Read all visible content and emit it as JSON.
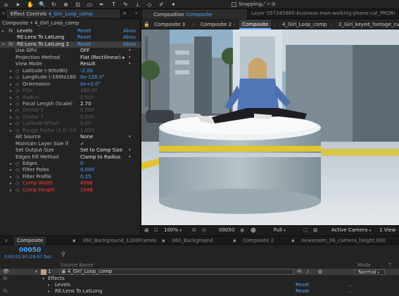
{
  "toolbar": {
    "snapping_label": "Snapping",
    "snapping_icons": "⤢ ⌗ ⊞",
    "tools": [
      {
        "name": "home-icon",
        "glyph": "⌂"
      },
      {
        "name": "selection-tool-icon",
        "glyph": "➤"
      },
      {
        "name": "hand-tool-icon",
        "glyph": "✋"
      },
      {
        "name": "zoom-tool-icon",
        "glyph": "🔍"
      },
      {
        "name": "rotate-tool-icon",
        "glyph": "↻"
      },
      {
        "name": "camera-tool-icon",
        "glyph": "⊕"
      },
      {
        "name": "pan-behind-tool-icon",
        "glyph": "⊡"
      },
      {
        "name": "rectangle-tool-icon",
        "glyph": "▭"
      },
      {
        "name": "pen-tool-icon",
        "glyph": "✒"
      },
      {
        "name": "type-tool-icon",
        "glyph": "T"
      },
      {
        "name": "brush-tool-icon",
        "glyph": "✎"
      },
      {
        "name": "clone-stamp-tool-icon",
        "glyph": "⊥"
      },
      {
        "name": "eraser-tool-icon",
        "glyph": "◇"
      },
      {
        "name": "roto-brush-tool-icon",
        "glyph": "✐"
      },
      {
        "name": "puppet-pin-tool-icon",
        "glyph": "✦"
      }
    ]
  },
  "effect_controls": {
    "close": "×",
    "tab_prefix": "Effect Controls",
    "tab_comp": "4_Girl_Loop_comp",
    "menu": "≡",
    "expand": "»",
    "breadcrumb": "Composite • 4_Girl_Loop_comp",
    "rows": [
      {
        "fx": "fx",
        "label": "Levels",
        "value": "Reset",
        "extra": "Abou",
        "tri": "▸"
      },
      {
        "fx": "",
        "label": "RE:Lens To LatLong",
        "value": "Reset",
        "extra": "Abou",
        "tri": ""
      },
      {
        "fx": "fx",
        "label": "RE:Lens To LatLong 2",
        "value": "Reset",
        "extra": "Abou",
        "tri": "▾"
      },
      {
        "label": "Use GPU",
        "value": "OFF",
        "dd": "▾"
      },
      {
        "label": "Projection Method",
        "value": "Flat (Rectilinear) ▸",
        "dd": "▾"
      },
      {
        "label": "View Mode",
        "value": "Result",
        "dd": "▾"
      },
      {
        "label": "Latitude (-90to90)",
        "value": "-2.00",
        "blue": true
      },
      {
        "label": "Longitude (-180to180",
        "value": "0x-128.0°",
        "blue": true
      },
      {
        "label": "Orientation",
        "value": "0x+0.0°",
        "blue": true
      },
      {
        "label": "FOV",
        "value": "180.00",
        "dim": true
      },
      {
        "label": "Radius",
        "value": "0.500",
        "dim": true
      },
      {
        "label": "Focal Length (Scale)",
        "value": "2.70",
        "blue": false
      },
      {
        "label": "Center X",
        "value": "0.500",
        "dim": true
      },
      {
        "label": "Center Y",
        "value": "0.500",
        "dim": true
      },
      {
        "label": "Latitude Offset",
        "value": "0.00",
        "dim": true
      },
      {
        "label": "Range Factor (1.0~10",
        "value": "1.000",
        "dim": true
      },
      {
        "label": "Alt Source",
        "value": "None",
        "dd": "▾"
      },
      {
        "label": "Maintain Layer Size if",
        "value": "✓"
      },
      {
        "label": "Set Output Size",
        "value": "Set to Comp Size",
        "dd": "▾"
      },
      {
        "label": "Edges Fill Method",
        "value": "Clamp to Radius",
        "dd": "▾"
      },
      {
        "label": "Edges",
        "value": "0",
        "blue": true
      },
      {
        "label": "Filter Poles",
        "value": "0.000",
        "blue": true
      },
      {
        "label": "Filter Profile",
        "value": "0.25",
        "blue": true
      },
      {
        "label": "Comp Width",
        "value": "4096",
        "red": true
      },
      {
        "label": "Comp Height",
        "value": "2048",
        "red": true
      }
    ]
  },
  "composition": {
    "tab_prefix": "Composition",
    "tab_comp": "Composite",
    "layer_tab": "Layer 057245685-business-man-walking-phone-cal_PRORI",
    "flow": [
      "Composite 3",
      "Composite 2",
      "Composite",
      "4_Girl_Loop_comp",
      "2_Girl_keyed_footage_cut"
    ],
    "active_flow": 2,
    "view_bar": {
      "zoom": "100%",
      "timecode": "00050",
      "resolution": "Full",
      "camera": "Active Camera",
      "views": "1 View"
    }
  },
  "timeline_tabs": [
    {
      "label": "Composite",
      "active": true
    },
    {
      "label": "360_Background_1200Frames",
      "active": false
    },
    {
      "label": "360_Background",
      "active": false
    },
    {
      "label": "Composite 2",
      "active": false
    },
    {
      "label": "newsroom_06_camera_height.000",
      "active": false
    }
  ],
  "timeline": {
    "current_time": "00050",
    "frames_info": "0;00;01;20 (29.97 fps)",
    "source_name_header": "Source Name",
    "mode_header": "Mode",
    "t_header": "T",
    "layer_num": "1",
    "layer_name": "4_Girl_Loop_comp",
    "mode": "Normal",
    "effects_label": "Effects",
    "levels_label": "Levels",
    "levels_reset": "Reset",
    "lens_label": "RE:Lens To LatLong",
    "lens_reset": "Reset",
    "dots": "...."
  },
  "colors": {
    "accent": "#4da3ff",
    "warning": "#ff3b3b",
    "panel": "#232323"
  }
}
